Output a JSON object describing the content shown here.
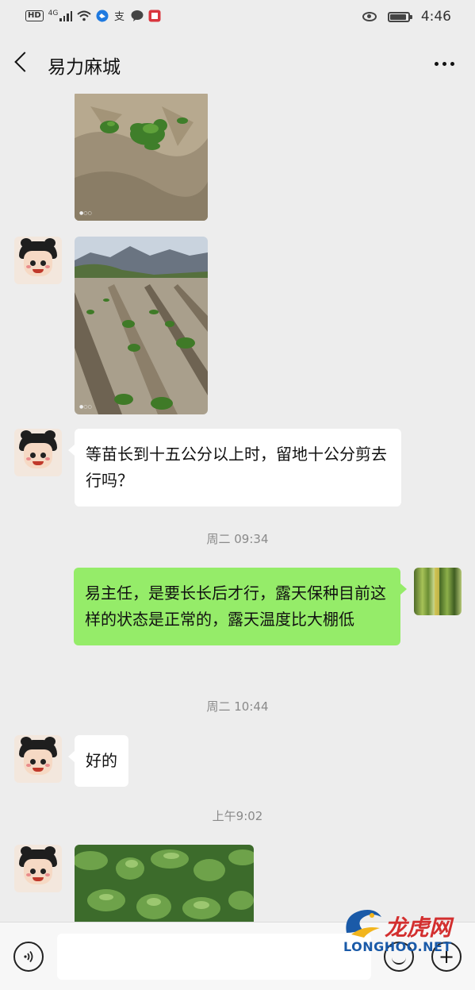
{
  "status_bar": {
    "hd": "HD",
    "network": "4G",
    "time": "4:46",
    "battery_level": 0.9,
    "left_icons": [
      "signal-icon",
      "wifi-icon",
      "app-notification-icon",
      "alipay-icon",
      "chat-notification-icon",
      "reader-icon"
    ],
    "right_icons": [
      "eye-comfort-icon",
      "battery-icon"
    ]
  },
  "nav": {
    "title": "易力麻城",
    "icons": [
      "back-icon",
      "more-icon"
    ]
  },
  "messages": {
    "m3_text": "等苗长到十五公分以上时，留地十公分剪去行吗？",
    "ts1": "周二 09:34",
    "m4_text": "易主任，是要长长后才行，露天保种目前这样的状态是正常的，露天温度比大棚低",
    "ts2": "周二 10:44",
    "m5_text": "好的",
    "ts3": "上午9:02"
  },
  "photos": [
    "seedling-photo",
    "field-photo",
    "leaves-photo"
  ],
  "bottom_bar": {
    "icons": [
      "voice-icon",
      "emoji-icon",
      "plus-icon"
    ],
    "input_value": ""
  },
  "watermark": {
    "cn": "龙虎网",
    "en": "LONGHOO.NET"
  },
  "colors": {
    "background": "#ededed",
    "incoming_bubble": "#ffffff",
    "outgoing_bubble": "#95ec69",
    "timestamp": "#8a8a8a"
  }
}
